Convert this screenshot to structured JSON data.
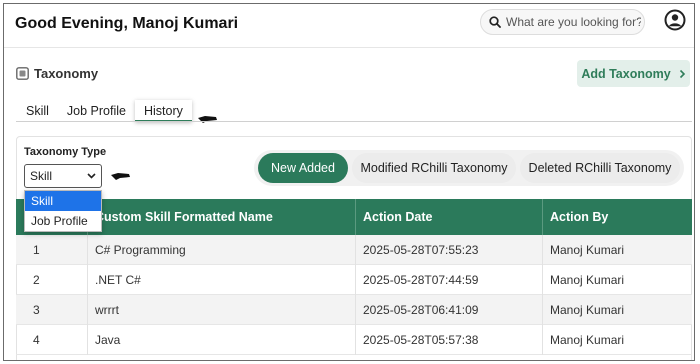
{
  "header": {
    "greeting": "Good Evening, Manoj Kumari",
    "search_placeholder": "What are you looking for?"
  },
  "page": {
    "title": "Taxonomy",
    "add_button": "Add Taxonomy",
    "tabs": [
      "Skill",
      "Job Profile",
      "History"
    ],
    "active_tab": "History"
  },
  "filter": {
    "label": "Taxonomy Type",
    "selected": "Skill",
    "options": [
      "Skill",
      "Job Profile"
    ]
  },
  "segments": [
    "New Added",
    "Modified RChilli Taxonomy",
    "Deleted RChilli Taxonomy"
  ],
  "table": {
    "columns": [
      "",
      "Custom Skill Formatted Name",
      "Action Date",
      "Action By"
    ],
    "rows": [
      [
        "1",
        "C# Programming",
        "2025-05-28T07:55:23",
        "Manoj Kumari"
      ],
      [
        "2",
        ".NET C#",
        "2025-05-28T07:44:59",
        "Manoj Kumari"
      ],
      [
        "3",
        "wrrrt",
        "2025-05-28T06:41:09",
        "Manoj Kumari"
      ],
      [
        "4",
        "Java",
        "2025-05-28T05:57:38",
        "Manoj Kumari"
      ]
    ]
  },
  "colors": {
    "accent": "#2b7a5b",
    "accent_light": "#e3efea",
    "select_highlight": "#1e73e8"
  }
}
